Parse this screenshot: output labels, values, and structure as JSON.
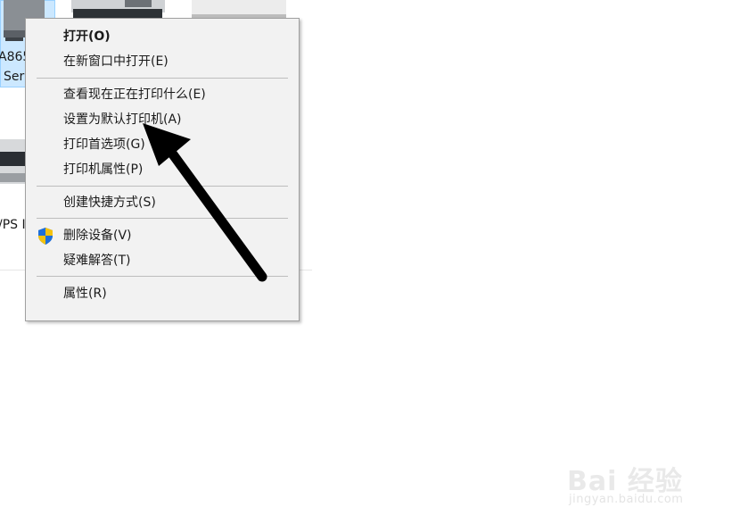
{
  "devices": {
    "selected_label_line1": "A865",
    "selected_label_line2": "Ser",
    "second_label": "/PS I"
  },
  "context_menu": {
    "items": [
      {
        "label": "打开(O)"
      },
      {
        "label": "在新窗口中打开(E)"
      },
      {
        "label": "查看现在正在打印什么(E)"
      },
      {
        "label": "设置为默认打印机(A)"
      },
      {
        "label": "打印首选项(G)"
      },
      {
        "label": "打印机属性(P)"
      },
      {
        "label": "创建快捷方式(S)"
      },
      {
        "label": "删除设备(V)"
      },
      {
        "label": "疑难解答(T)"
      },
      {
        "label": "属性(R)"
      }
    ]
  },
  "watermark": {
    "brand": "Bai 经验",
    "url": "jingyan.baidu.com"
  },
  "colors": {
    "menu_bg": "#f2f2f2",
    "selection_bg": "#cce8ff",
    "arrow": "#000000"
  }
}
